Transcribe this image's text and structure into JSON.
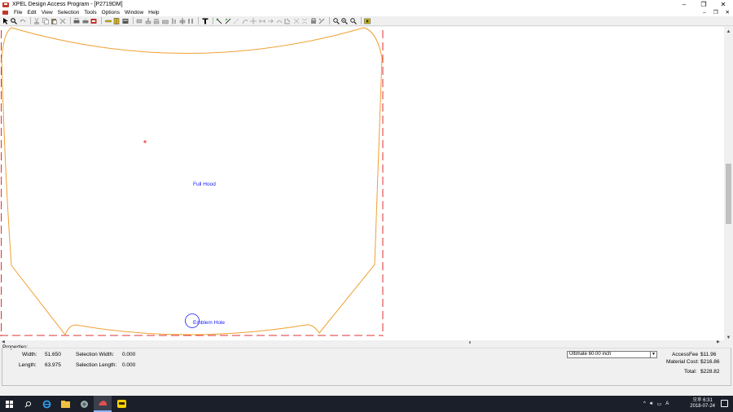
{
  "window": {
    "title": "XPEL Design Access Program - [P2719DM]",
    "controls": {
      "minimize": "–",
      "maximize": "❐",
      "close": "✕"
    },
    "mdi_controls": {
      "minimize": "–",
      "restore": "❐",
      "close": "✕"
    }
  },
  "menu": {
    "items": [
      "File",
      "Edit",
      "View",
      "Selection",
      "Tools",
      "Options",
      "Window",
      "Help"
    ]
  },
  "toolbar": {
    "icons": [
      "pointer-icon",
      "zoom-icon",
      "undo-icon",
      "cut-icon",
      "copy-icon",
      "paste-icon",
      "delete-icon",
      "print-icon",
      "print-preview-icon",
      "plot-icon",
      "measure-icon",
      "mirror-icon",
      "cutter-icon",
      "align-left-icon",
      "align-center-icon",
      "align-right-icon",
      "align-top-icon",
      "align-middle-icon",
      "align-bottom-icon",
      "text-icon",
      "node-edit-icon",
      "knife-icon",
      "line-icon",
      "move-icon",
      "rotate-icon",
      "scale-icon",
      "weld-icon",
      "bend-icon",
      "stretch-icon",
      "snap-icon",
      "zoom-in-icon",
      "zoom-out-icon",
      "zoom-fit-icon",
      "export-icon"
    ]
  },
  "canvas": {
    "pattern_label": "Full Hood",
    "hole_label": "Emblem Hole",
    "colors": {
      "outline": "#f0a030",
      "guide": "#e03030",
      "label": "#1a1aff",
      "marker": "#ff0000"
    }
  },
  "properties": {
    "title": "Properties:",
    "width_label": "Width:",
    "width_value": "51.650",
    "length_label": "Length:",
    "length_value": "63.975",
    "sel_width_label": "Selection Width:",
    "sel_width_value": "0.000",
    "sel_length_label": "Selection Length:",
    "sel_length_value": "0.000",
    "material_selected": "Ultimate 60.00 inch",
    "access_fee_label": "AccessFee",
    "access_fee_value": "$11.96",
    "material_cost_label": "Material Cost:",
    "material_cost_value": "$216.86",
    "total_label": "Total:",
    "total_value": "$228.82"
  },
  "taskbar": {
    "ime": "A",
    "time_period": "오후 6:31",
    "date": "2018-07-24"
  }
}
